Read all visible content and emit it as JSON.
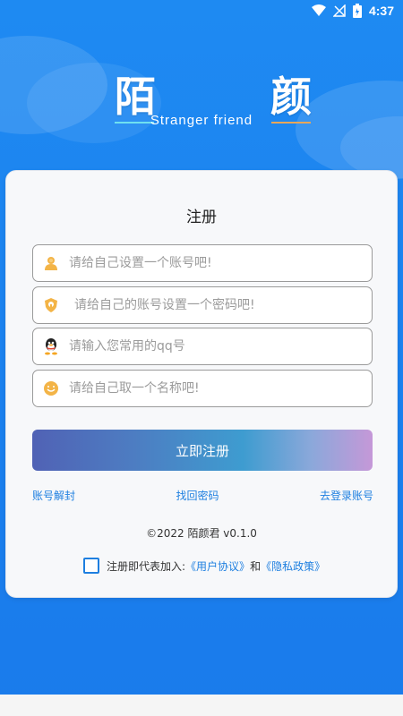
{
  "status_bar": {
    "time": "4:37"
  },
  "logo": {
    "char_left": "陌",
    "char_right": "颜",
    "subtitle": "Stranger friend"
  },
  "register_card": {
    "title": "注册",
    "fields": [
      {
        "placeholder": "请给自己设置一个账号吧!",
        "icon": "user-icon",
        "value": ""
      },
      {
        "placeholder": "请给自己的账号设置一个密码吧!",
        "icon": "lock-shield-icon",
        "value": ""
      },
      {
        "placeholder": "请输入您常用的qq号",
        "icon": "qq-penguin-icon",
        "value": ""
      },
      {
        "placeholder": "请给自己取一个名称吧!",
        "icon": "smile-icon",
        "value": ""
      }
    ],
    "submit_label": "立即注册",
    "links": {
      "unfreeze": "账号解封",
      "recover": "找回密码",
      "login": "去登录账号"
    },
    "copyright": "©2022 陌颜君 v0.1.0",
    "agreement": {
      "prefix": "注册即代表加入:",
      "user_agreement": "《用户协议》",
      "conjunction": "和",
      "privacy_policy": "《隐私政策》"
    }
  },
  "colors": {
    "background": "#1E86F0",
    "link": "#1E7FE0",
    "card": "#F7F8FA"
  }
}
